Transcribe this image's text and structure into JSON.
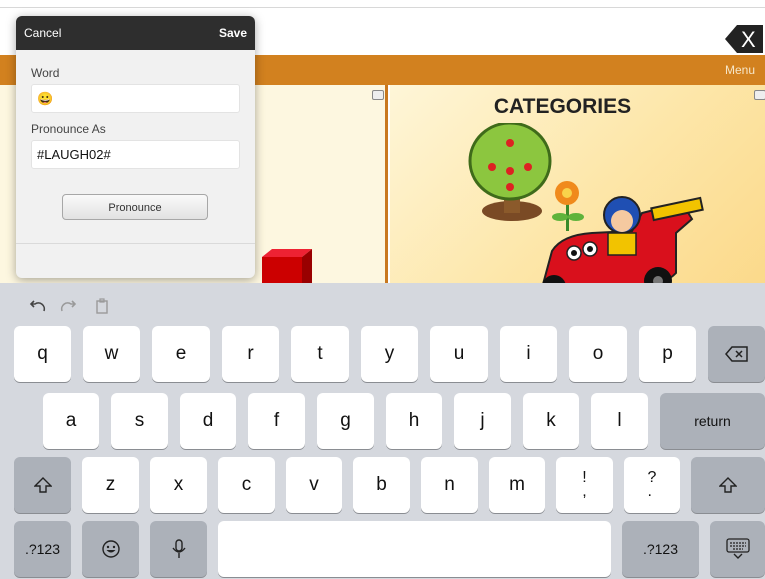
{
  "close_button": {
    "label": "X"
  },
  "category_bar": {
    "menu_label": "Menu"
  },
  "tiles": {
    "right_title": "CATEGORIES"
  },
  "popover": {
    "cancel_label": "Cancel",
    "save_label": "Save",
    "word_label": "Word",
    "word_value": "😀",
    "pronounce_label": "Pronounce As",
    "pronounce_value": "#LAUGH02#",
    "pronounce_button": "Pronounce"
  },
  "keyboard": {
    "toolbar": [
      "undo-icon",
      "redo-icon",
      "paste-icon"
    ],
    "row1": [
      "q",
      "w",
      "e",
      "r",
      "t",
      "y",
      "u",
      "i",
      "o",
      "p"
    ],
    "row2": [
      "a",
      "s",
      "d",
      "f",
      "g",
      "h",
      "j",
      "k",
      "l"
    ],
    "row3": [
      "z",
      "x",
      "c",
      "v",
      "b",
      "n",
      "m",
      "!\n,",
      "?\n."
    ],
    "return_label": "return",
    "numbers_label": ".?123",
    "icons": [
      "delete-icon",
      "shift-icon",
      "emoji-icon",
      "microphone-icon",
      "keyboard-dismiss-icon"
    ]
  }
}
